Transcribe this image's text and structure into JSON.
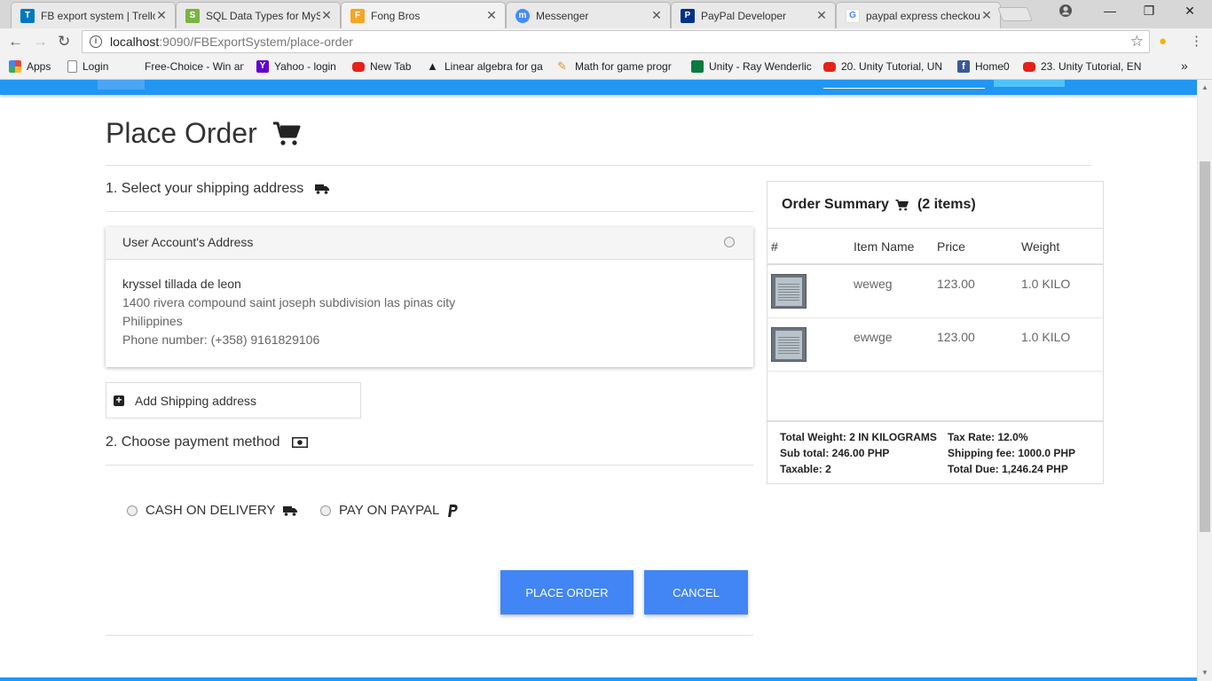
{
  "browser": {
    "tabs": [
      {
        "title": "FB export system | Trello",
        "color": "#0079bf",
        "glyph": "T"
      },
      {
        "title": "SQL Data Types for MySQL",
        "color": "#7cb342",
        "glyph": "S"
      },
      {
        "title": "Fong Bros",
        "color": "#f5a623",
        "glyph": "F"
      },
      {
        "title": "Messenger",
        "color": "#448aff",
        "glyph": "m"
      },
      {
        "title": "PayPal Developer",
        "color": "#003087",
        "glyph": "P"
      },
      {
        "title": "paypal express checkout",
        "color": "#4285f4",
        "glyph": "G"
      }
    ],
    "active_tab_index": 2,
    "url_host": "localhost",
    "url_path": ":9090/FBExportSystem/place-order",
    "bookmarks": [
      {
        "label": "Apps",
        "icon": "apps-grid-icon",
        "color": "#e8453c"
      },
      {
        "label": "Login",
        "icon": "page-icon",
        "color": "#ffffff"
      },
      {
        "label": "Free-Choice - Win an",
        "icon": "blank-icon",
        "color": "#f2f2f2"
      },
      {
        "label": "Yahoo - login",
        "icon": "yahoo-icon",
        "color": "#5f01d1"
      },
      {
        "label": "New Tab",
        "icon": "youtube-icon",
        "color": "#e62117"
      },
      {
        "label": "Linear algebra for ga",
        "icon": "unity-icon",
        "color": "#222222"
      },
      {
        "label": "Math for game progr",
        "icon": "pencil-icon",
        "color": "#f0c060"
      },
      {
        "label": "Unity - Ray Wenderlic",
        "icon": "rw-icon",
        "color": "#0b7a3e"
      },
      {
        "label": "20. Unity Tutorial, UN",
        "icon": "youtube-icon",
        "color": "#e62117"
      },
      {
        "label": "Home0",
        "icon": "facebook-icon",
        "color": "#3b5998"
      },
      {
        "label": "23. Unity Tutorial, EN",
        "icon": "youtube-icon",
        "color": "#e62117"
      }
    ],
    "bookmarks_more": "»"
  },
  "page": {
    "title": "Place Order",
    "step1": "1. Select your shipping address",
    "address_card": {
      "header": "User Account's Address",
      "name": "kryssel tillada de leon",
      "line1": "1400 rivera compound saint joseph subdivision las pinas city",
      "line2": "Philippines",
      "phone": "Phone number: (+358) 9161829106"
    },
    "add_shipping": "Add Shipping address",
    "step2": "2. Choose payment method",
    "payment_options": {
      "cod": "CASH ON DELIVERY",
      "paypal": "PAY ON PAYPAL"
    },
    "buttons": {
      "place_order": "PLACE ORDER",
      "cancel": "CANCEL"
    }
  },
  "summary": {
    "title": "Order Summary",
    "count": "(2 items)",
    "columns": [
      "#",
      "Item Name",
      "Price",
      "Weight"
    ],
    "items": [
      {
        "name": "weweg",
        "price": "123.00",
        "weight": "1.0 KILO"
      },
      {
        "name": "ewwge",
        "price": "123.00",
        "weight": "1.0 KILO"
      }
    ],
    "totals": {
      "total_weight": "Total Weight: 2 IN KILOGRAMS",
      "sub_total": "Sub total: 246.00 PHP",
      "taxable": "Taxable: 2",
      "tax_rate": "Tax Rate: 12.0%",
      "shipping_fee": "Shipping fee: 1000.0 PHP",
      "total_due": "Total Due: 1,246.24 PHP"
    }
  },
  "colors": {
    "brand_blue": "#2196f3",
    "button_blue": "#4285f4"
  }
}
